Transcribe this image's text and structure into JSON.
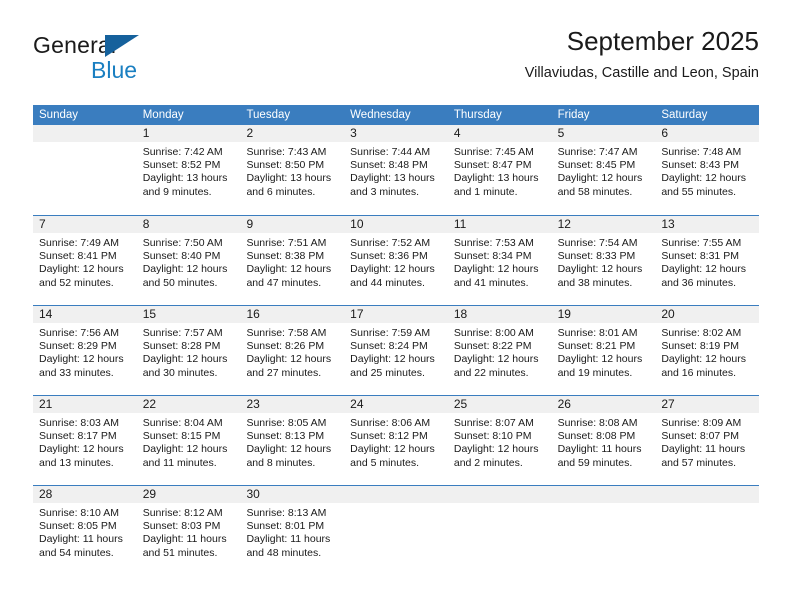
{
  "brand": {
    "name_part1": "General",
    "name_part2": "Blue",
    "accent_color": "#1a7fc1",
    "triangle_color": "#15619c"
  },
  "header": {
    "title": "September 2025",
    "subtitle": "Villaviudas, Castille and Leon, Spain"
  },
  "calendar": {
    "header_bg": "#3a7dbf",
    "daynum_bg": "#f0f0f0",
    "weekday_headers": [
      "Sunday",
      "Monday",
      "Tuesday",
      "Wednesday",
      "Thursday",
      "Friday",
      "Saturday"
    ],
    "weeks": [
      [
        {
          "day": "",
          "sunrise": "",
          "sunset": "",
          "daylight": ""
        },
        {
          "day": "1",
          "sunrise": "Sunrise: 7:42 AM",
          "sunset": "Sunset: 8:52 PM",
          "daylight": "Daylight: 13 hours and 9 minutes."
        },
        {
          "day": "2",
          "sunrise": "Sunrise: 7:43 AM",
          "sunset": "Sunset: 8:50 PM",
          "daylight": "Daylight: 13 hours and 6 minutes."
        },
        {
          "day": "3",
          "sunrise": "Sunrise: 7:44 AM",
          "sunset": "Sunset: 8:48 PM",
          "daylight": "Daylight: 13 hours and 3 minutes."
        },
        {
          "day": "4",
          "sunrise": "Sunrise: 7:45 AM",
          "sunset": "Sunset: 8:47 PM",
          "daylight": "Daylight: 13 hours and 1 minute."
        },
        {
          "day": "5",
          "sunrise": "Sunrise: 7:47 AM",
          "sunset": "Sunset: 8:45 PM",
          "daylight": "Daylight: 12 hours and 58 minutes."
        },
        {
          "day": "6",
          "sunrise": "Sunrise: 7:48 AM",
          "sunset": "Sunset: 8:43 PM",
          "daylight": "Daylight: 12 hours and 55 minutes."
        }
      ],
      [
        {
          "day": "7",
          "sunrise": "Sunrise: 7:49 AM",
          "sunset": "Sunset: 8:41 PM",
          "daylight": "Daylight: 12 hours and 52 minutes."
        },
        {
          "day": "8",
          "sunrise": "Sunrise: 7:50 AM",
          "sunset": "Sunset: 8:40 PM",
          "daylight": "Daylight: 12 hours and 50 minutes."
        },
        {
          "day": "9",
          "sunrise": "Sunrise: 7:51 AM",
          "sunset": "Sunset: 8:38 PM",
          "daylight": "Daylight: 12 hours and 47 minutes."
        },
        {
          "day": "10",
          "sunrise": "Sunrise: 7:52 AM",
          "sunset": "Sunset: 8:36 PM",
          "daylight": "Daylight: 12 hours and 44 minutes."
        },
        {
          "day": "11",
          "sunrise": "Sunrise: 7:53 AM",
          "sunset": "Sunset: 8:34 PM",
          "daylight": "Daylight: 12 hours and 41 minutes."
        },
        {
          "day": "12",
          "sunrise": "Sunrise: 7:54 AM",
          "sunset": "Sunset: 8:33 PM",
          "daylight": "Daylight: 12 hours and 38 minutes."
        },
        {
          "day": "13",
          "sunrise": "Sunrise: 7:55 AM",
          "sunset": "Sunset: 8:31 PM",
          "daylight": "Daylight: 12 hours and 36 minutes."
        }
      ],
      [
        {
          "day": "14",
          "sunrise": "Sunrise: 7:56 AM",
          "sunset": "Sunset: 8:29 PM",
          "daylight": "Daylight: 12 hours and 33 minutes."
        },
        {
          "day": "15",
          "sunrise": "Sunrise: 7:57 AM",
          "sunset": "Sunset: 8:28 PM",
          "daylight": "Daylight: 12 hours and 30 minutes."
        },
        {
          "day": "16",
          "sunrise": "Sunrise: 7:58 AM",
          "sunset": "Sunset: 8:26 PM",
          "daylight": "Daylight: 12 hours and 27 minutes."
        },
        {
          "day": "17",
          "sunrise": "Sunrise: 7:59 AM",
          "sunset": "Sunset: 8:24 PM",
          "daylight": "Daylight: 12 hours and 25 minutes."
        },
        {
          "day": "18",
          "sunrise": "Sunrise: 8:00 AM",
          "sunset": "Sunset: 8:22 PM",
          "daylight": "Daylight: 12 hours and 22 minutes."
        },
        {
          "day": "19",
          "sunrise": "Sunrise: 8:01 AM",
          "sunset": "Sunset: 8:21 PM",
          "daylight": "Daylight: 12 hours and 19 minutes."
        },
        {
          "day": "20",
          "sunrise": "Sunrise: 8:02 AM",
          "sunset": "Sunset: 8:19 PM",
          "daylight": "Daylight: 12 hours and 16 minutes."
        }
      ],
      [
        {
          "day": "21",
          "sunrise": "Sunrise: 8:03 AM",
          "sunset": "Sunset: 8:17 PM",
          "daylight": "Daylight: 12 hours and 13 minutes."
        },
        {
          "day": "22",
          "sunrise": "Sunrise: 8:04 AM",
          "sunset": "Sunset: 8:15 PM",
          "daylight": "Daylight: 12 hours and 11 minutes."
        },
        {
          "day": "23",
          "sunrise": "Sunrise: 8:05 AM",
          "sunset": "Sunset: 8:13 PM",
          "daylight": "Daylight: 12 hours and 8 minutes."
        },
        {
          "day": "24",
          "sunrise": "Sunrise: 8:06 AM",
          "sunset": "Sunset: 8:12 PM",
          "daylight": "Daylight: 12 hours and 5 minutes."
        },
        {
          "day": "25",
          "sunrise": "Sunrise: 8:07 AM",
          "sunset": "Sunset: 8:10 PM",
          "daylight": "Daylight: 12 hours and 2 minutes."
        },
        {
          "day": "26",
          "sunrise": "Sunrise: 8:08 AM",
          "sunset": "Sunset: 8:08 PM",
          "daylight": "Daylight: 11 hours and 59 minutes."
        },
        {
          "day": "27",
          "sunrise": "Sunrise: 8:09 AM",
          "sunset": "Sunset: 8:07 PM",
          "daylight": "Daylight: 11 hours and 57 minutes."
        }
      ],
      [
        {
          "day": "28",
          "sunrise": "Sunrise: 8:10 AM",
          "sunset": "Sunset: 8:05 PM",
          "daylight": "Daylight: 11 hours and 54 minutes."
        },
        {
          "day": "29",
          "sunrise": "Sunrise: 8:12 AM",
          "sunset": "Sunset: 8:03 PM",
          "daylight": "Daylight: 11 hours and 51 minutes."
        },
        {
          "day": "30",
          "sunrise": "Sunrise: 8:13 AM",
          "sunset": "Sunset: 8:01 PM",
          "daylight": "Daylight: 11 hours and 48 minutes."
        },
        {
          "day": "",
          "sunrise": "",
          "sunset": "",
          "daylight": ""
        },
        {
          "day": "",
          "sunrise": "",
          "sunset": "",
          "daylight": ""
        },
        {
          "day": "",
          "sunrise": "",
          "sunset": "",
          "daylight": ""
        },
        {
          "day": "",
          "sunrise": "",
          "sunset": "",
          "daylight": ""
        }
      ]
    ]
  }
}
